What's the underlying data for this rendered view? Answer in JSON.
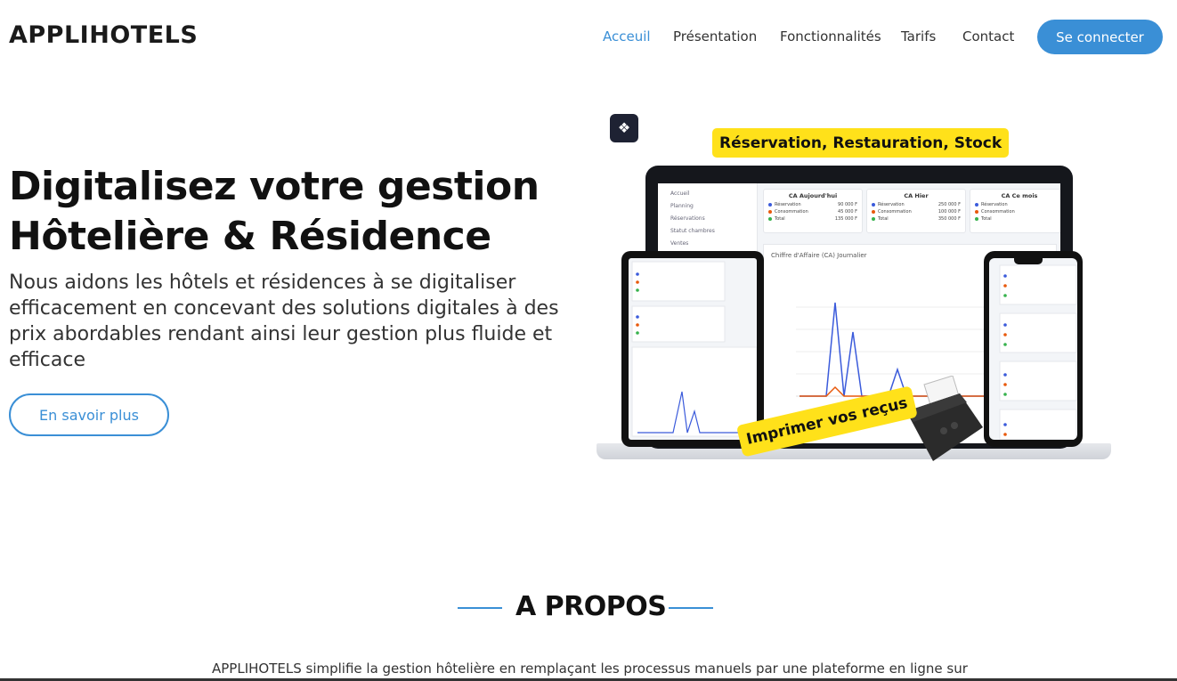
{
  "header": {
    "brand": "APPLIHOTELS",
    "nav": [
      "Acceuil",
      "Présentation",
      "Fonctionnalités",
      "Tarifs",
      "Contact"
    ],
    "active_nav": "Acceuil",
    "cta": "Se connecter"
  },
  "hero": {
    "title_line1": "Digitalisez votre gestion",
    "title_line2": "Hôtelière & Résidence",
    "description": "Nous aidons les hôtels et résidences à se digitaliser efficacement en concevant des solutions digitales à des prix abordables rendant ainsi leur gestion plus fluide et efficace",
    "button": "En savoir plus"
  },
  "illustration": {
    "tag_top": "Réservation, Restauration, Stock",
    "tag_bottom": "Imprimer vos reçus",
    "sidebar": [
      "Accueil",
      "Planning",
      "Réservations",
      "Statut chambres",
      "Ventes"
    ],
    "cards": [
      {
        "title": "CA Aujourd'hui",
        "rows": [
          [
            "Réservation",
            "90 000 F"
          ],
          [
            "Consommation",
            "45 000 F"
          ],
          [
            "Total",
            "135 000 F"
          ]
        ]
      },
      {
        "title": "CA Hier",
        "rows": [
          [
            "Réservation",
            "250 000 F"
          ],
          [
            "Consommation",
            "100 000 F"
          ],
          [
            "Total",
            "350 000 F"
          ]
        ]
      },
      {
        "title": "CA Ce mois",
        "rows": [
          [
            "Réservation",
            ""
          ],
          [
            "Consommation",
            ""
          ],
          [
            "Total",
            ""
          ]
        ]
      }
    ],
    "chart_title": "Chiffre d'Affaire (CA) Journalier",
    "colors": {
      "reservation": "#3b5bdb",
      "consommation": "#e8590c",
      "total": "#37b24d"
    }
  },
  "about": {
    "heading": "A PROPOS",
    "text": "APPLIHOTELS simplifie la gestion hôtelière en remplaçant les processus manuels par une plateforme en ligne sur"
  },
  "colors": {
    "accent": "#3a8fd6",
    "highlight": "#ffe11a"
  }
}
